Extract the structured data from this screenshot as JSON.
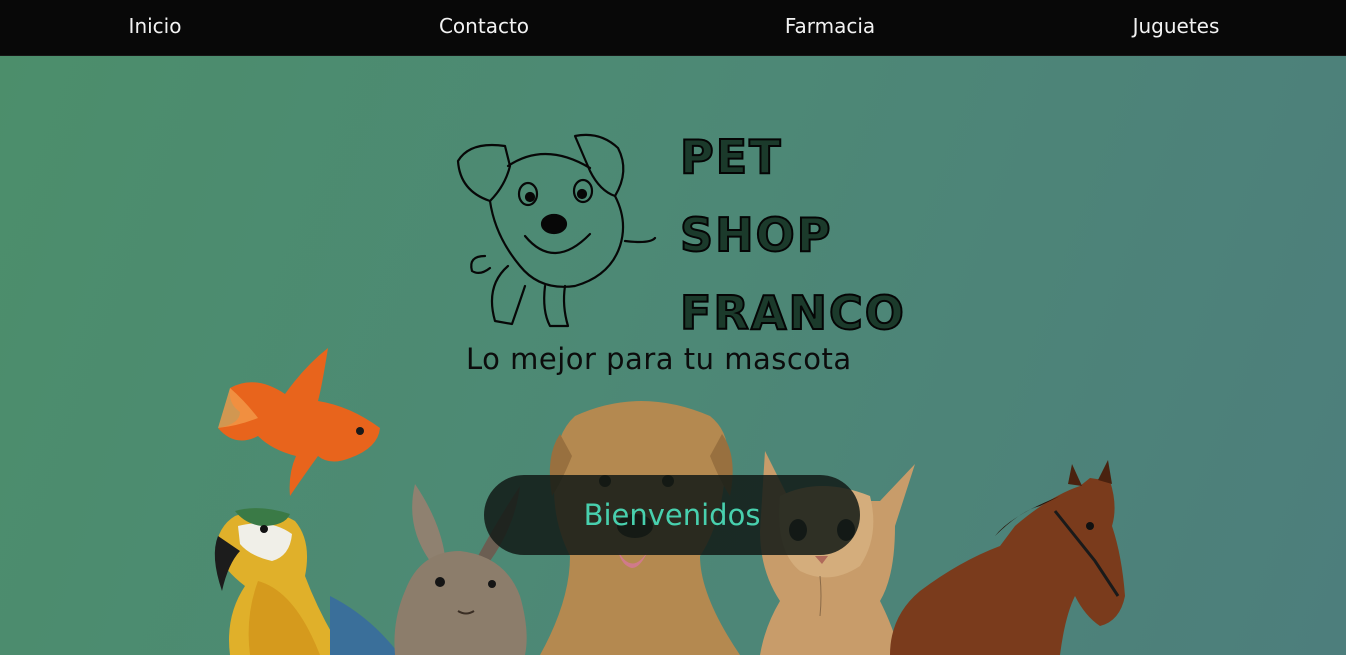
{
  "nav": {
    "items": [
      {
        "label": "Inicio"
      },
      {
        "label": "Contacto"
      },
      {
        "label": "Farmacia"
      },
      {
        "label": "Juguetes"
      }
    ]
  },
  "logo": {
    "lines": [
      "PET",
      "SHOP",
      "FRANCO"
    ],
    "tagline": "Lo mejor para tu mascota",
    "icon": "dog-logo-icon"
  },
  "hero": {
    "welcome": "Bienvenidos",
    "animals": [
      "goldfish",
      "parrot",
      "rabbit",
      "dog",
      "cat",
      "horse"
    ]
  },
  "colors": {
    "nav_bg": "#080808",
    "hero_gradient_start": "#4c8e6b",
    "hero_gradient_end": "#4d7e7c",
    "welcome_text": "#48d0ae",
    "welcome_bg": "#121a16"
  }
}
